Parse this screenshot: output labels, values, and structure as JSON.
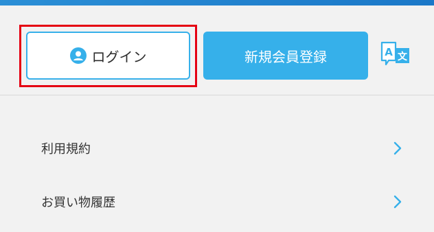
{
  "header": {
    "login_label": "ログイン",
    "register_label": "新規会員登録",
    "translate_icon": "translate-icon",
    "user_icon": "user-circle-icon"
  },
  "menu": {
    "items": [
      {
        "label": "利用規約",
        "icon": "chevron-right-icon"
      },
      {
        "label": "お買い物履歴",
        "icon": "chevron-right-icon"
      }
    ]
  },
  "colors": {
    "accent": "#36b0ea",
    "highlight": "#e50012",
    "topbar": "#1b78c8",
    "background": "#f2f2f2",
    "text": "#333333"
  }
}
